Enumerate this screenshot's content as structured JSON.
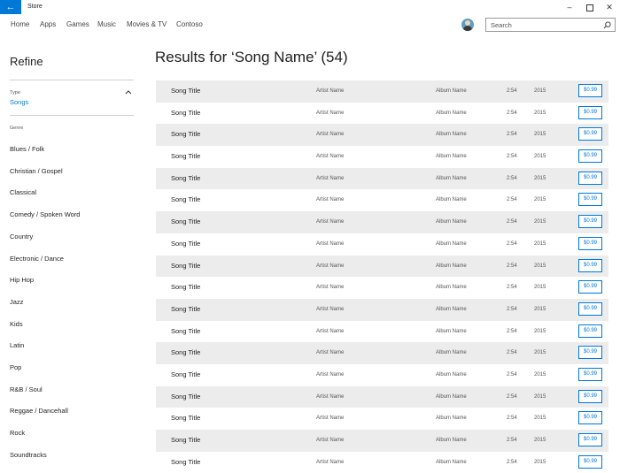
{
  "window": {
    "title": "Store"
  },
  "nav": {
    "items": [
      "Home",
      "Apps",
      "Games",
      "Music",
      "Movies & TV",
      "Contoso"
    ]
  },
  "search": {
    "placeholder": "Search"
  },
  "sidebar": {
    "title": "Refine",
    "type_label": "Type",
    "type_value": "Songs",
    "genre_label": "Genre",
    "genres": [
      "Blues / Folk",
      "Christian / Gospel",
      "Classical",
      "Comedy / Spoken Word",
      "Country",
      "Electronic / Dance",
      "Hip Hop",
      "Jazz",
      "Kids",
      "Latin",
      "Pop",
      "R&B / Soul",
      "Reggae / Dancehall",
      "Rock",
      "Soundtracks"
    ]
  },
  "results": {
    "title": "Results for ‘Song Name’ (54)",
    "rows": [
      {
        "title": "Song Title",
        "artist": "Artist Name",
        "album": "Album Name",
        "duration": "2:54",
        "year": "2015",
        "price": "$0.99"
      },
      {
        "title": "Song Title",
        "artist": "Artist Name",
        "album": "Album Name",
        "duration": "2:54",
        "year": "2015",
        "price": "$0.99"
      },
      {
        "title": "Song Title",
        "artist": "Artist Name",
        "album": "Album Name",
        "duration": "2:54",
        "year": "2015",
        "price": "$0.99"
      },
      {
        "title": "Song Title",
        "artist": "Artist Name",
        "album": "Album Name",
        "duration": "2:54",
        "year": "2015",
        "price": "$0.99"
      },
      {
        "title": "Song Title",
        "artist": "Artist Name",
        "album": "Album Name",
        "duration": "2:54",
        "year": "2015",
        "price": "$0.99"
      },
      {
        "title": "Song Title",
        "artist": "Artist Name",
        "album": "Album Name",
        "duration": "2:54",
        "year": "2015",
        "price": "$0.99"
      },
      {
        "title": "Song Title",
        "artist": "Artist Name",
        "album": "Album Name",
        "duration": "2:54",
        "year": "2015",
        "price": "$0.99"
      },
      {
        "title": "Song Title",
        "artist": "Artist Name",
        "album": "Album Name",
        "duration": "2:54",
        "year": "2015",
        "price": "$0.99"
      },
      {
        "title": "Song Title",
        "artist": "Artist Name",
        "album": "Album Name",
        "duration": "2:54",
        "year": "2015",
        "price": "$0.99"
      },
      {
        "title": "Song Title",
        "artist": "Artist Name",
        "album": "Album Name",
        "duration": "2:54",
        "year": "2015",
        "price": "$0.99"
      },
      {
        "title": "Song Title",
        "artist": "Artist Name",
        "album": "Album Name",
        "duration": "2:54",
        "year": "2015",
        "price": "$0.99"
      },
      {
        "title": "Song Title",
        "artist": "Artist Name",
        "album": "Album Name",
        "duration": "2:54",
        "year": "2015",
        "price": "$0.99"
      },
      {
        "title": "Song Title",
        "artist": "Artist Name",
        "album": "Album Name",
        "duration": "2:54",
        "year": "2015",
        "price": "$0.99"
      },
      {
        "title": "Song Title",
        "artist": "Artist Name",
        "album": "Album Name",
        "duration": "2:54",
        "year": "2015",
        "price": "$0.99"
      },
      {
        "title": "Song Title",
        "artist": "Artist Name",
        "album": "Album Name",
        "duration": "2:54",
        "year": "2015",
        "price": "$0.99"
      },
      {
        "title": "Song Title",
        "artist": "Artist Name",
        "album": "Album Name",
        "duration": "2:54",
        "year": "2015",
        "price": "$0.99"
      },
      {
        "title": "Song Title",
        "artist": "Artist Name",
        "album": "Album Name",
        "duration": "2:54",
        "year": "2015",
        "price": "$0.99"
      },
      {
        "title": "Song Title",
        "artist": "Artist Name",
        "album": "Album Name",
        "duration": "2:54",
        "year": "2015",
        "price": "$0.99"
      }
    ]
  },
  "colors": {
    "accent": "#0078d7",
    "stripe": "#ececec"
  },
  "icons": {
    "back": "back-arrow-icon",
    "search": "search-icon",
    "avatar": "avatar-icon",
    "collapse": "chevron-up-icon"
  }
}
